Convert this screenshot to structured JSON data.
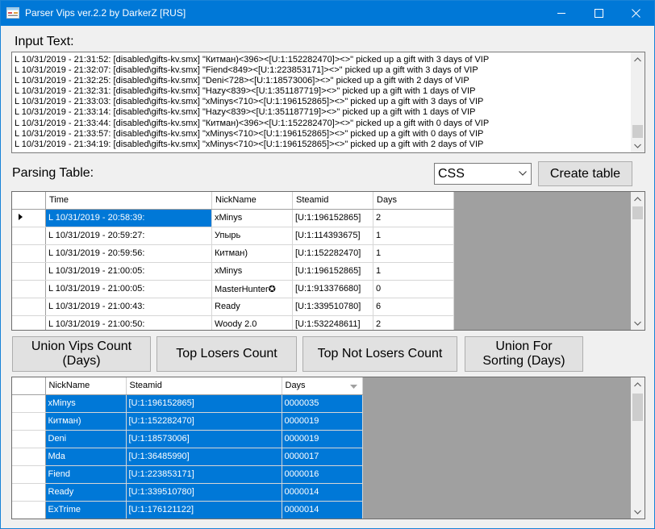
{
  "window": {
    "title": "Parser Vips ver.2.2 by DarkerZ [RUS]",
    "accent": "#0078d7"
  },
  "input_label": "Input Text:",
  "log_lines": [
    "L 10/31/2019 - 21:31:52: [disabled\\gifts-kv.smx] \"Китман)<396><[U:1:152282470]><>\" picked up a gift with 3 days of VIP",
    "L 10/31/2019 - 21:32:07: [disabled\\gifts-kv.smx] \"Fiend<849><[U:1:223853171]><>\" picked up a gift with 3 days of VIP",
    "L 10/31/2019 - 21:32:25: [disabled\\gifts-kv.smx] \"Deni<728><[U:1:18573006]><>\" picked up a gift with 2 days of VIP",
    "L 10/31/2019 - 21:32:31: [disabled\\gifts-kv.smx] \"Hazy<839><[U:1:351187719]><>\" picked up a gift with 1 days of VIP",
    "L 10/31/2019 - 21:33:03: [disabled\\gifts-kv.smx] \"xMinys<710><[U:1:196152865]><>\" picked up a gift with 3 days of VIP",
    "L 10/31/2019 - 21:33:14: [disabled\\gifts-kv.smx] \"Hazy<839><[U:1:351187719]><>\" picked up a gift with 1 days of VIP",
    "L 10/31/2019 - 21:33:44: [disabled\\gifts-kv.smx] \"Китман)<396><[U:1:152282470]><>\" picked up a gift with 0 days of VIP",
    "L 10/31/2019 - 21:33:57: [disabled\\gifts-kv.smx] \"xMinys<710><[U:1:196152865]><>\" picked up a gift with 0 days of VIP",
    "L 10/31/2019 - 21:34:19: [disabled\\gifts-kv.smx] \"xMinys<710><[U:1:196152865]><>\" picked up a gift with 2 days of VIP"
  ],
  "parsing_label": "Parsing Table:",
  "combo": {
    "value": "CSS"
  },
  "buttons": {
    "create": "Create table",
    "union_vips": "Union Vips Count (Days)",
    "top_losers": "Top Losers Count",
    "top_not_losers": "Top Not Losers Count",
    "union_sorting": "Union For Sorting (Days)"
  },
  "parsing_table": {
    "columns": [
      "Time",
      "NickName",
      "Steamid",
      "Days"
    ],
    "rows": [
      [
        "L 10/31/2019 - 20:58:39:",
        "xMinys",
        "[U:1:196152865]",
        "2"
      ],
      [
        "L 10/31/2019 - 20:59:27:",
        "Упырь",
        "[U:1:114393675]",
        "1"
      ],
      [
        "L 10/31/2019 - 20:59:56:",
        "Китман)",
        "[U:1:152282470]",
        "1"
      ],
      [
        "L 10/31/2019 - 21:00:05:",
        "xMinys",
        "[U:1:196152865]",
        "1"
      ],
      [
        "L 10/31/2019 - 21:00:05:",
        "MasterHunter✪",
        "[U:1:913376680]",
        "0"
      ],
      [
        "L 10/31/2019 - 21:00:43:",
        "Ready",
        "[U:1:339510780]",
        "6"
      ],
      [
        "L 10/31/2019 - 21:00:50:",
        "Woody 2.0",
        "[U:1:532248611]",
        "2"
      ]
    ]
  },
  "result_table": {
    "columns": [
      "NickName",
      "Steamid",
      "Days"
    ],
    "rows": [
      [
        "xMinys",
        "[U:1:196152865]",
        "0000035"
      ],
      [
        "Китман)",
        "[U:1:152282470]",
        "0000019"
      ],
      [
        "Deni",
        "[U:1:18573006]",
        "0000019"
      ],
      [
        "Mda",
        "[U:1:36485990]",
        "0000017"
      ],
      [
        "Fiend",
        "[U:1:223853171]",
        "0000016"
      ],
      [
        "Ready",
        "[U:1:339510780]",
        "0000014"
      ],
      [
        "ExTrime",
        "[U:1:176121122]",
        "0000014"
      ]
    ]
  }
}
